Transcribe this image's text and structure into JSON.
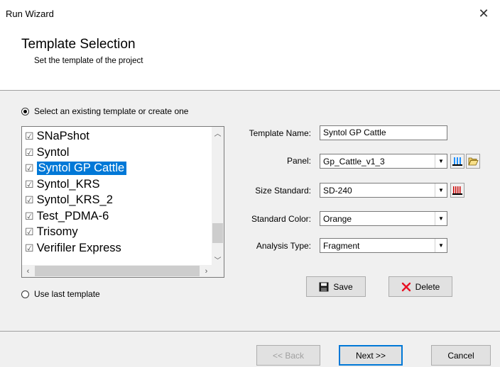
{
  "window": {
    "title": "Run Wizard"
  },
  "header": {
    "title": "Template Selection",
    "subtitle": "Set the template of the project"
  },
  "options": {
    "existing": "Select an existing template or create one",
    "last": "Use last template"
  },
  "templates": [
    "SNaPshot",
    "Syntol",
    "Syntol GP Cattle",
    "Syntol_KRS",
    "Syntol_KRS_2",
    "Test_PDMA-6",
    "Trisomy",
    "Verifiler Express"
  ],
  "selected_template": "Syntol GP Cattle",
  "form": {
    "template_name_label": "Template Name:",
    "template_name_value": "Syntol GP Cattle",
    "panel_label": "Panel:",
    "panel_value": "Gp_Cattle_v1_3",
    "size_standard_label": "Size Standard:",
    "size_standard_value": "SD-240",
    "standard_color_label": "Standard Color:",
    "standard_color_value": "Orange",
    "analysis_type_label": "Analysis Type:",
    "analysis_type_value": "Fragment"
  },
  "actions": {
    "save": "Save",
    "delete": "Delete"
  },
  "footer": {
    "back": "<< Back",
    "next": "Next >>",
    "cancel": "Cancel"
  },
  "colors": {
    "selection": "#0078d7",
    "delete_red": "#e81123",
    "panel_icon_blue": "#1e90ff",
    "size_icon_red": "#cc0000"
  }
}
